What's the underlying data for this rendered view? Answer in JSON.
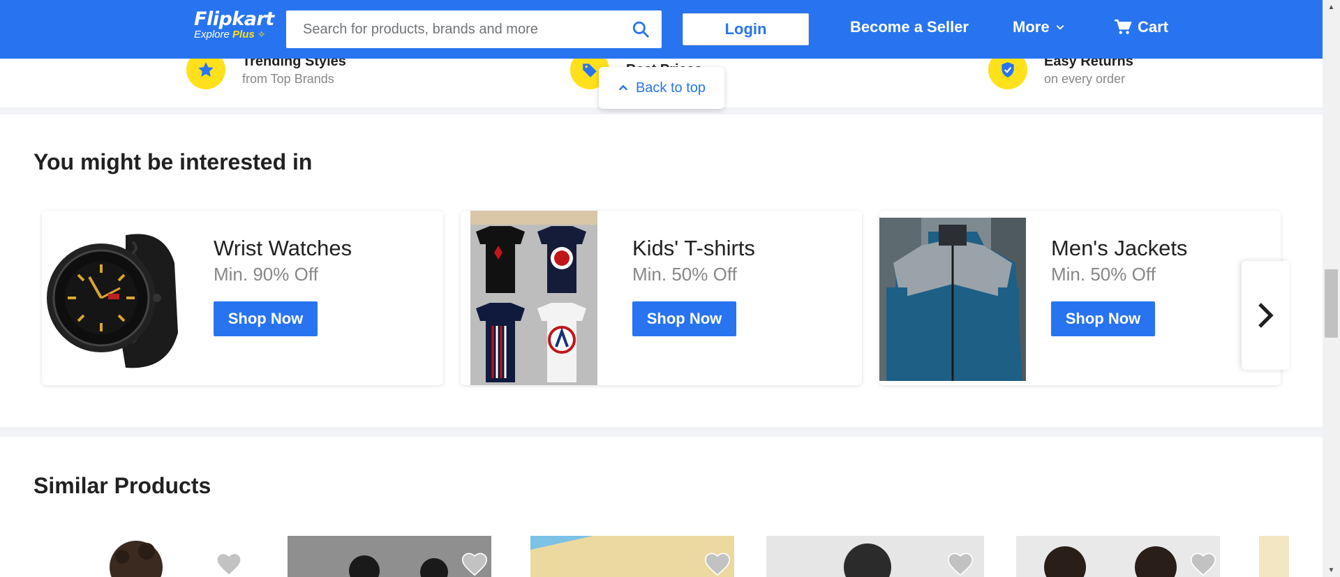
{
  "header": {
    "logo_text": "Flipkart",
    "logo_sub_explore": "Explore",
    "logo_sub_plus": "Plus",
    "search_placeholder": "Search for products, brands and more",
    "login_label": "Login",
    "seller_label": "Become a Seller",
    "more_label": "More",
    "cart_label": "Cart"
  },
  "features": [
    {
      "title": "Trending Styles",
      "subtitle": "from Top Brands",
      "icon": "star-icon"
    },
    {
      "title": "Best Prices",
      "subtitle": "",
      "icon": "tag-icon"
    },
    {
      "title": "Easy Returns",
      "subtitle": "on every order",
      "icon": "shield-check-icon"
    }
  ],
  "back_to_top_label": "Back to top",
  "interested": {
    "title": "You might be interested in",
    "cards": [
      {
        "title": "Wrist Watches",
        "subtitle": "Min. 90% Off",
        "button": "Shop Now"
      },
      {
        "title": "Kids' T-shirts",
        "subtitle": "Min. 50% Off",
        "button": "Shop Now"
      },
      {
        "title": "Men's Jackets",
        "subtitle": "Min. 50% Off",
        "button": "Shop Now"
      }
    ]
  },
  "similar": {
    "title": "Similar Products"
  },
  "colors": {
    "brand_blue": "#2874f0",
    "brand_yellow": "#ffe11b"
  }
}
